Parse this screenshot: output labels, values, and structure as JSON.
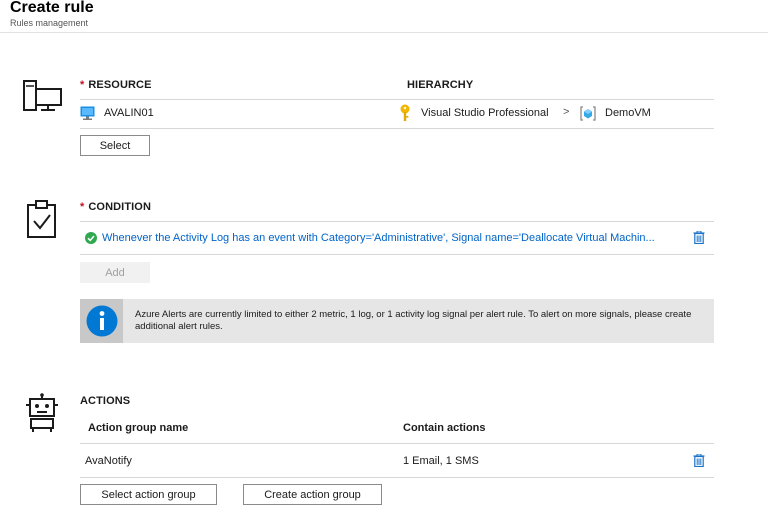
{
  "header": {
    "title": "Create rule",
    "subtitle": "Rules management"
  },
  "resource": {
    "label": "RESOURCE",
    "hierarchy_label": "HIERARCHY",
    "name": "AVALIN01",
    "subscription": "Visual Studio Professional",
    "separator": ">",
    "resource_group": "DemoVM",
    "select_label": "Select"
  },
  "condition": {
    "label": "CONDITION",
    "text": "Whenever the Activity Log has an event with Category='Administrative', Signal name='Deallocate Virtual Machin...",
    "add_label": "Add",
    "info_text": "Azure Alerts are currently limited to either 2 metric, 1 log, or 1 activity log signal per alert rule. To alert on more signals, please create additional alert rules."
  },
  "actions": {
    "label": "ACTIONS",
    "columns": [
      "Action group name",
      "Contain actions"
    ],
    "rows": [
      {
        "name": "AvaNotify",
        "actions": "1 Email, 1 SMS"
      }
    ],
    "select_group_label": "Select action group",
    "create_group_label": "Create action group"
  },
  "colors": {
    "accent": "#0064c8",
    "required": "#c50f1f",
    "success": "#2fa84f",
    "info": "#0078d4"
  }
}
